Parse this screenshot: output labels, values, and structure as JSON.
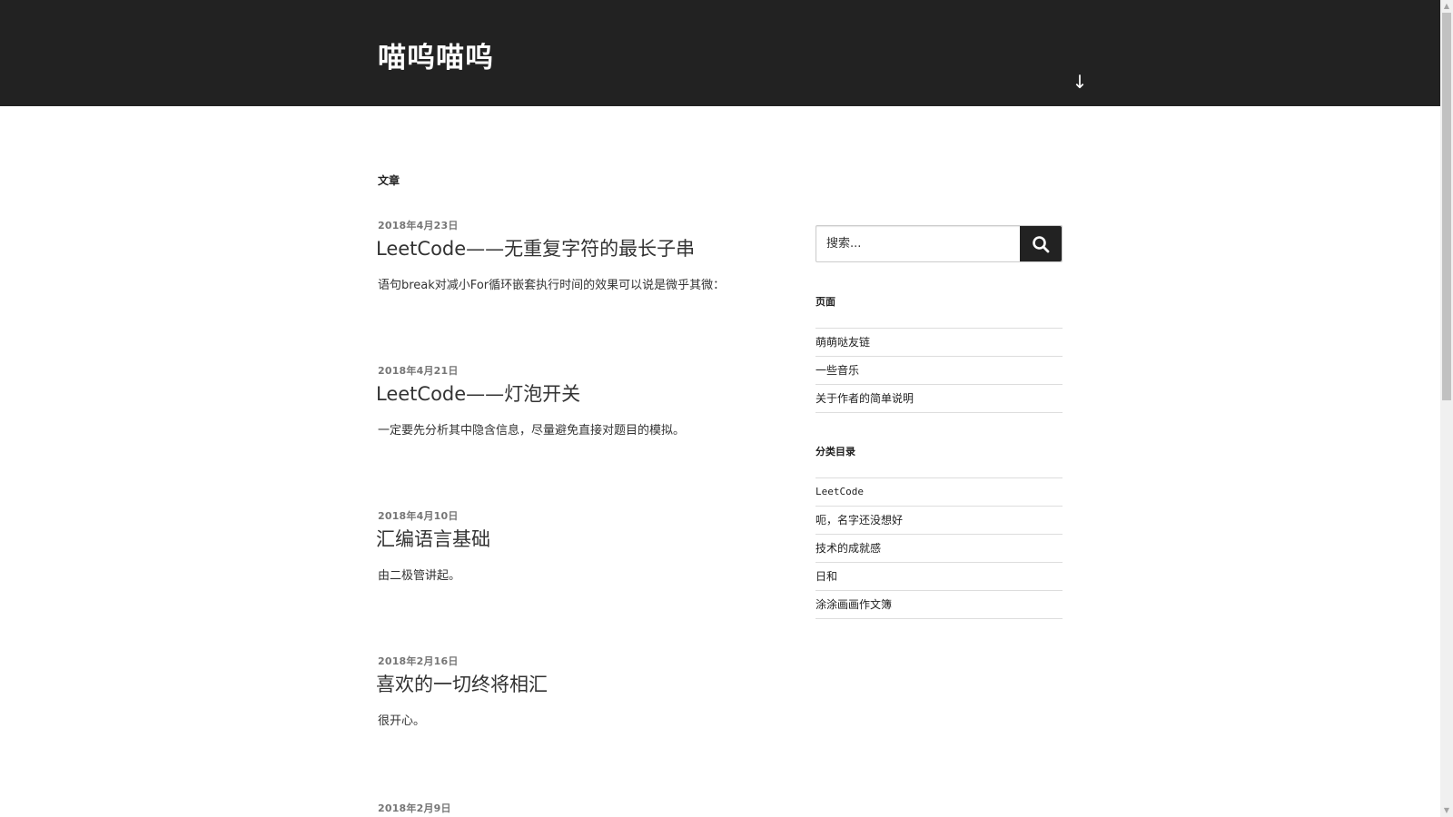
{
  "header": {
    "site_title": "喵呜喵呜",
    "scroll_down_icon": "arrow-down-icon",
    "scroll_down_glyph": "↓"
  },
  "main": {
    "page_title": "文章",
    "posts": [
      {
        "date": "2018年4月23日",
        "title": "LeetCode——无重复字符的最长子串",
        "excerpt": "语句break对减小For循环嵌套执行时间的效果可以说是微乎其微："
      },
      {
        "date": "2018年4月21日",
        "title": "LeetCode——灯泡开关",
        "excerpt": "一定要先分析其中隐含信息，尽量避免直接对题目的模拟。"
      },
      {
        "date": "2018年4月10日",
        "title": "汇编语言基础",
        "excerpt": "由二极管讲起。"
      },
      {
        "date": "2018年2月16日",
        "title": "喜欢的一切终将相汇",
        "excerpt": "很开心。"
      },
      {
        "date": "2018年2月9日",
        "title": "",
        "excerpt": ""
      }
    ]
  },
  "sidebar": {
    "search": {
      "placeholder": "搜索...",
      "icon": "search-icon"
    },
    "pages_widget": {
      "title": "页面",
      "items": [
        "萌萌哒友链",
        "一些音乐",
        "关于作者的简单说明"
      ]
    },
    "categories_widget": {
      "title": "分类目录",
      "items": [
        "LeetCode",
        "呃，名字还没想好",
        "技术的成就感",
        "日和",
        "涂涂画画作文簿"
      ]
    }
  },
  "colors": {
    "header_bg": "#222222",
    "header_text": "#ffffff",
    "text": "#333333",
    "meta": "#767676",
    "border": "#dddddd"
  }
}
